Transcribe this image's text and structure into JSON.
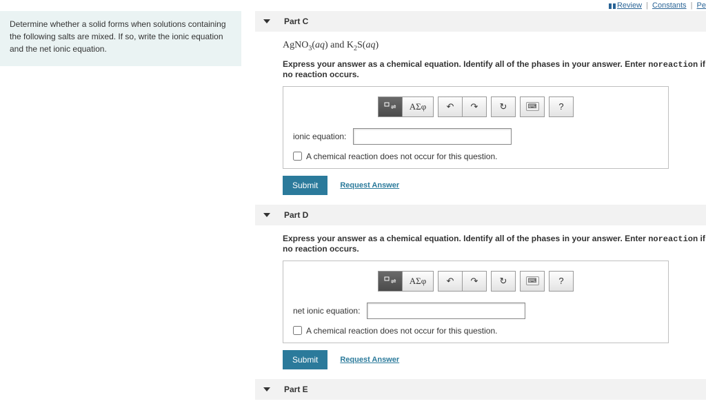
{
  "topLinks": {
    "review": "Review",
    "constants": "Constants",
    "periodic": "Pe"
  },
  "sidebar": {
    "text": "Determine whether a solid forms when solutions containing the following salts are mixed. If so, write the ionic equation and the net ionic equation."
  },
  "instruction": {
    "pre": "Express your answer as a chemical equation. Identify all of the phases in your answer. Enter ",
    "code": "noreaction",
    "post": " if no reaction occurs."
  },
  "toolbar": {
    "greek": "ΑΣφ",
    "undo": "↶",
    "redo": "↷",
    "reset": "↻",
    "help": "?"
  },
  "noReaction": "A chemical reaction does not occur for this question.",
  "buttons": {
    "submit": "Submit",
    "request": "Request Answer"
  },
  "partC": {
    "title": "Part C",
    "reagentsHtml": "AgNO<sub>3</sub>(<i>aq</i>) and K<sub>2</sub>S(<i>aq</i>)",
    "fieldLabel": "ionic equation:"
  },
  "partD": {
    "title": "Part D",
    "fieldLabel": "net ionic equation:"
  },
  "partE": {
    "title": "Part E"
  },
  "chart_data": null
}
